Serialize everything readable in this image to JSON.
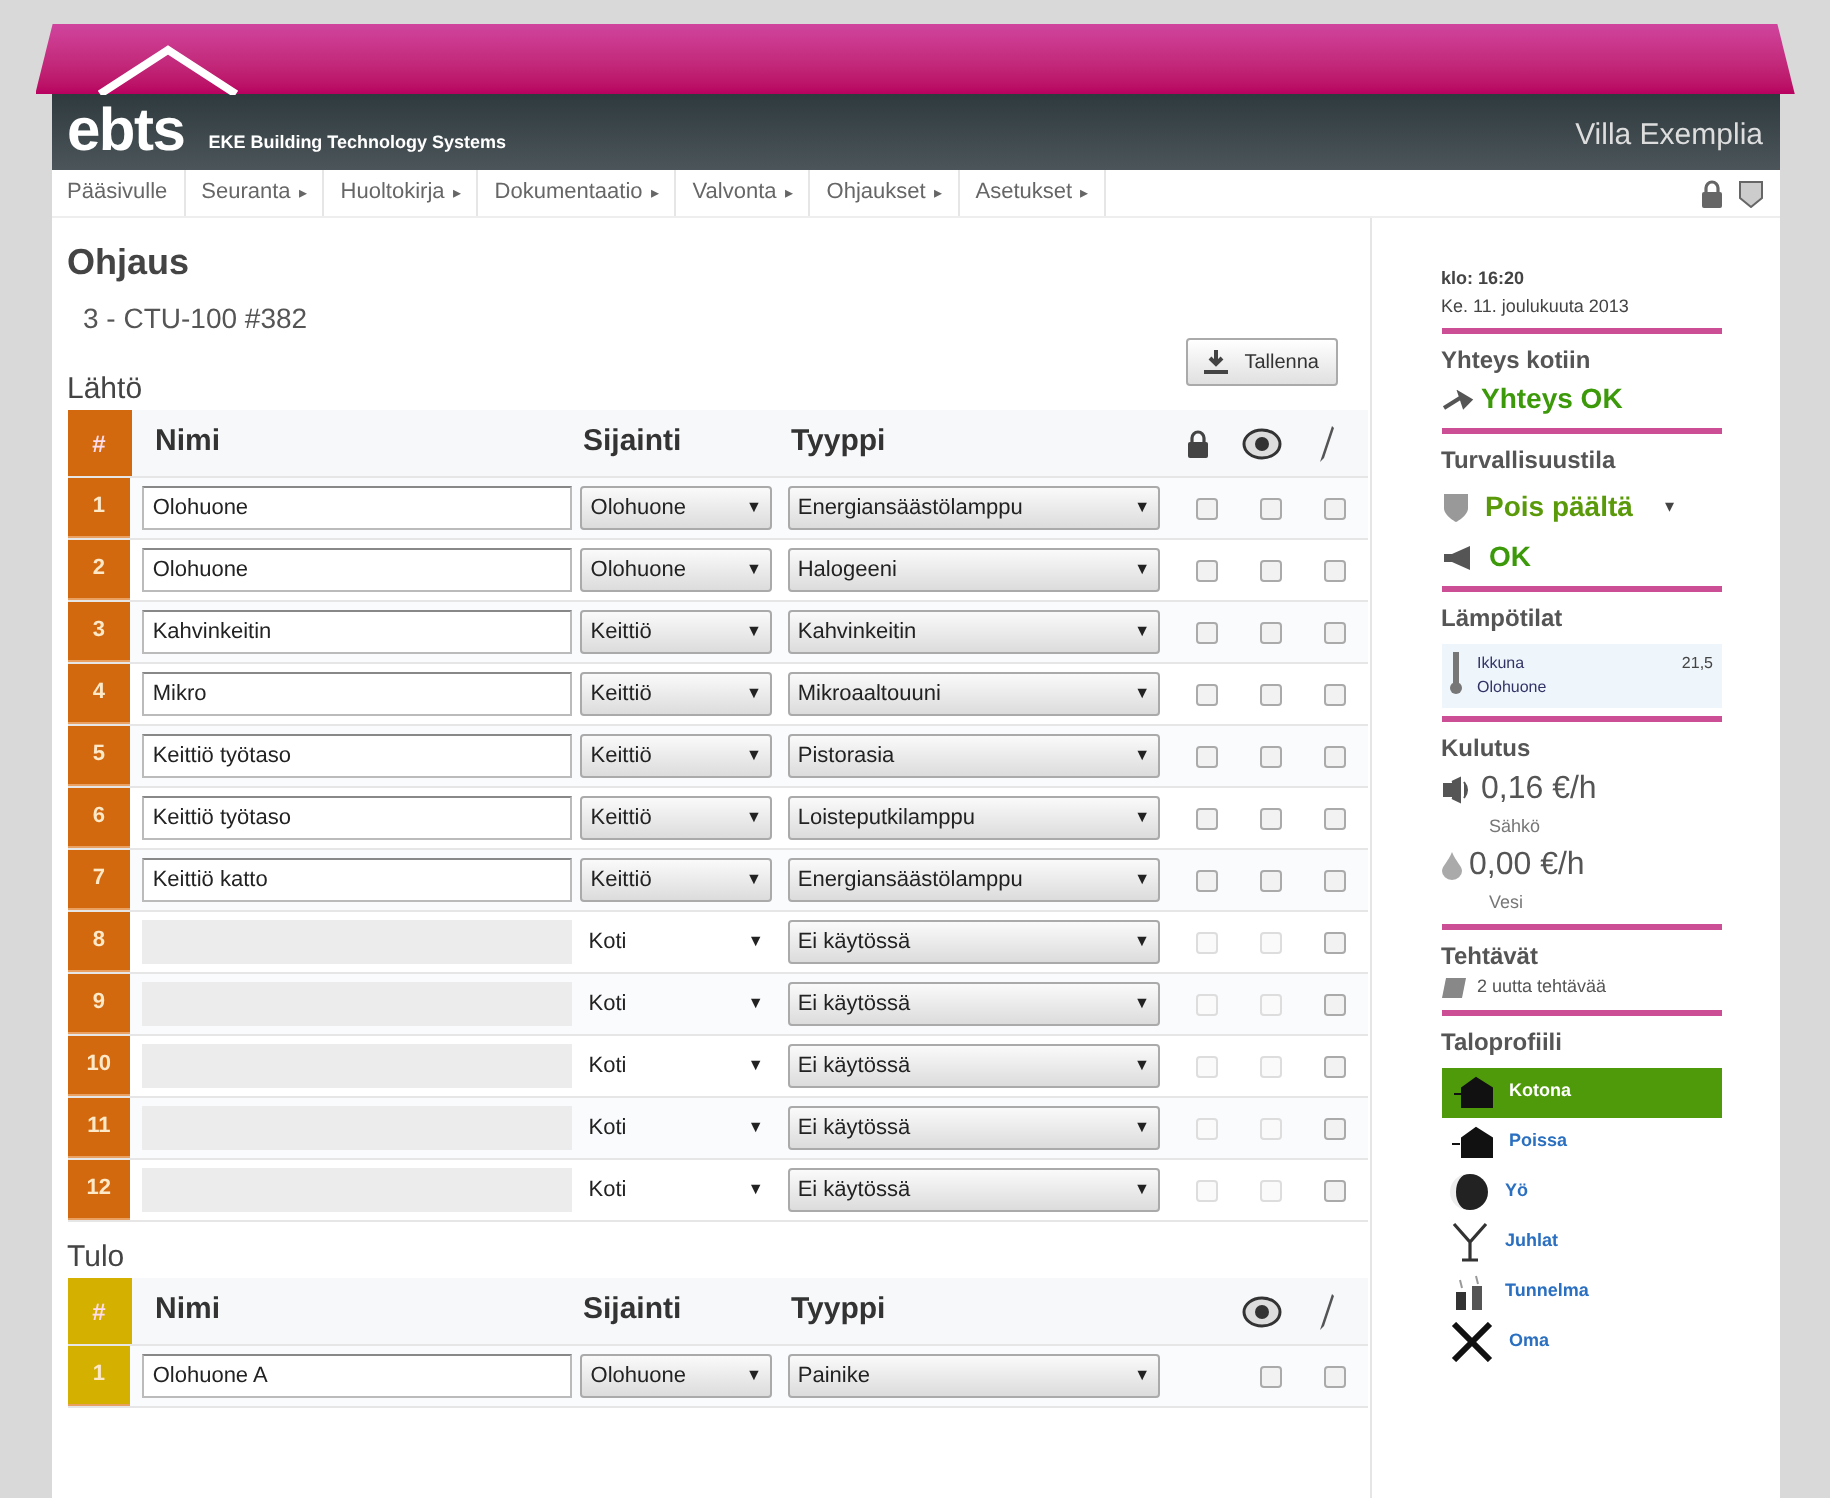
{
  "header": {
    "brand": "ebts",
    "tagline": "EKE Building Technology Systems",
    "site": "Villa Exemplia"
  },
  "nav": [
    {
      "label": "Pääsivulle",
      "submenu": false
    },
    {
      "label": "Seuranta",
      "submenu": true
    },
    {
      "label": "Huoltokirja",
      "submenu": true
    },
    {
      "label": "Dokumentaatio",
      "submenu": true
    },
    {
      "label": "Valvonta",
      "submenu": true
    },
    {
      "label": "Ohjaukset",
      "submenu": true
    },
    {
      "label": "Asetukset",
      "submenu": true
    }
  ],
  "nav_arrow": "▸",
  "title": "Ohjaus",
  "device": "3 - CTU-100 #382",
  "save_button": "Tallenna",
  "tables": [
    {
      "label": "Lähtö",
      "color": "#d2690e",
      "columns": {
        "number": "#",
        "name": "Nimi",
        "location": "Sijainti",
        "type": "Tyyppi"
      },
      "lock_column": true,
      "select_arrow": "▼",
      "rows": [
        {
          "number": "1",
          "name": "Olohuone",
          "location": "Olohuone",
          "type": "Energiansäästölamppu",
          "disabled": false,
          "lock": false,
          "visible": false,
          "edit": false
        },
        {
          "number": "2",
          "name": "Olohuone",
          "location": "Olohuone",
          "type": "Halogeeni",
          "disabled": false,
          "lock": false,
          "visible": false,
          "edit": false
        },
        {
          "number": "3",
          "name": "Kahvinkeitin",
          "location": "Keittiö",
          "type": "Kahvinkeitin",
          "disabled": false,
          "lock": false,
          "visible": false,
          "edit": false
        },
        {
          "number": "4",
          "name": "Mikro",
          "location": "Keittiö",
          "type": "Mikroaaltouuni",
          "disabled": false,
          "lock": false,
          "visible": false,
          "edit": false
        },
        {
          "number": "5",
          "name": "Keittiö työtaso",
          "location": "Keittiö",
          "type": "Pistorasia",
          "disabled": false,
          "lock": false,
          "visible": false,
          "edit": false
        },
        {
          "number": "6",
          "name": "Keittiö työtaso",
          "location": "Keittiö",
          "type": "Loisteputkilamppu",
          "disabled": false,
          "lock": false,
          "visible": false,
          "edit": false
        },
        {
          "number": "7",
          "name": "Keittiö katto",
          "location": "Keittiö",
          "type": "Energiansäästölamppu",
          "disabled": false,
          "lock": false,
          "visible": false,
          "edit": false
        },
        {
          "number": "8",
          "location": "Koti",
          "type": "Ei käytössä",
          "disabled": true,
          "lock": false,
          "visible": false,
          "edit": false
        },
        {
          "number": "9",
          "location": "Koti",
          "type": "Ei käytössä",
          "disabled": true,
          "lock": false,
          "visible": false,
          "edit": false
        },
        {
          "number": "10",
          "location": "Koti",
          "type": "Ei käytössä",
          "disabled": true,
          "lock": false,
          "visible": false,
          "edit": false
        },
        {
          "number": "11",
          "location": "Koti",
          "type": "Ei käytössä",
          "disabled": true,
          "lock": false,
          "visible": false,
          "edit": false
        },
        {
          "number": "12",
          "location": "Koti",
          "type": "Ei käytössä",
          "disabled": true,
          "lock": false,
          "visible": false,
          "edit": false
        }
      ]
    },
    {
      "label": "Tulo",
      "color": "#d4b000",
      "columns": {
        "number": "#",
        "name": "Nimi",
        "location": "Sijainti",
        "type": "Tyyppi"
      },
      "lock_column": false,
      "select_arrow": "▼",
      "rows": [
        {
          "number": "1",
          "name": "Olohuone A",
          "location": "Olohuone",
          "type": "Painike",
          "disabled": false,
          "visible": false,
          "edit": false
        }
      ]
    }
  ],
  "sidebar": {
    "time": "klo: 16:20",
    "date": "Ke. 11. joulukuuta 2013",
    "connection": {
      "title": "Yhteys kotiin",
      "status": "Yhteys OK"
    },
    "security": {
      "title": "Turvallisuustila",
      "mode": "Pois päältä",
      "dropdown": "▾",
      "status": "OK"
    },
    "temperatures": {
      "title": "Lämpötilat",
      "items": [
        {
          "name": "Ikkuna",
          "value": "21,5",
          "room": "Olohuone"
        }
      ]
    },
    "consumption": {
      "title": "Kulutus",
      "items": [
        {
          "kind": "electricity",
          "value": "0,16 €/h",
          "label": "Sähkö"
        },
        {
          "kind": "water",
          "value": "0,00 €/h",
          "label": "Vesi"
        }
      ]
    },
    "tasks": {
      "title": "Tehtävät",
      "text": "2 uutta tehtävää"
    },
    "profiles": {
      "title": "Taloprofiili",
      "items": [
        {
          "kind": "home",
          "label": "Kotona",
          "selected": true
        },
        {
          "kind": "away",
          "label": "Poissa",
          "selected": false
        },
        {
          "kind": "night",
          "label": "Yö",
          "selected": false
        },
        {
          "kind": "party",
          "label": "Juhlat",
          "selected": false
        },
        {
          "kind": "mood",
          "label": "Tunnelma",
          "selected": false
        },
        {
          "kind": "custom",
          "label": "Oma",
          "selected": false
        }
      ]
    }
  }
}
